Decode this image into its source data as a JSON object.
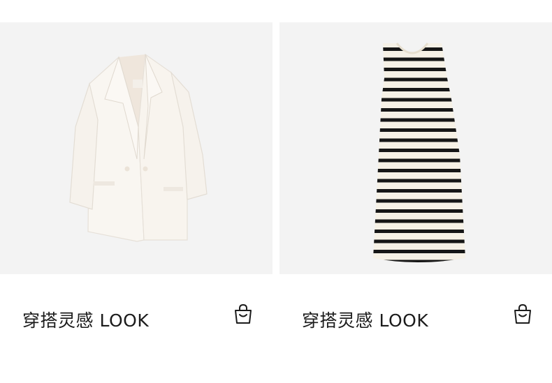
{
  "products": [
    {
      "caption": "穿搭灵感 LOOK",
      "icon": "shopping-bag-icon",
      "image": "white-blazer"
    },
    {
      "caption": "穿搭灵感 LOOK",
      "icon": "shopping-bag-icon",
      "image": "striped-knit-dress"
    }
  ],
  "colors": {
    "photo_bg": "#f3f3f3",
    "blazer": "#f8f4ee",
    "dress_base": "#f6f1e6",
    "stripe": "#161616",
    "text": "#1b1b1b"
  }
}
